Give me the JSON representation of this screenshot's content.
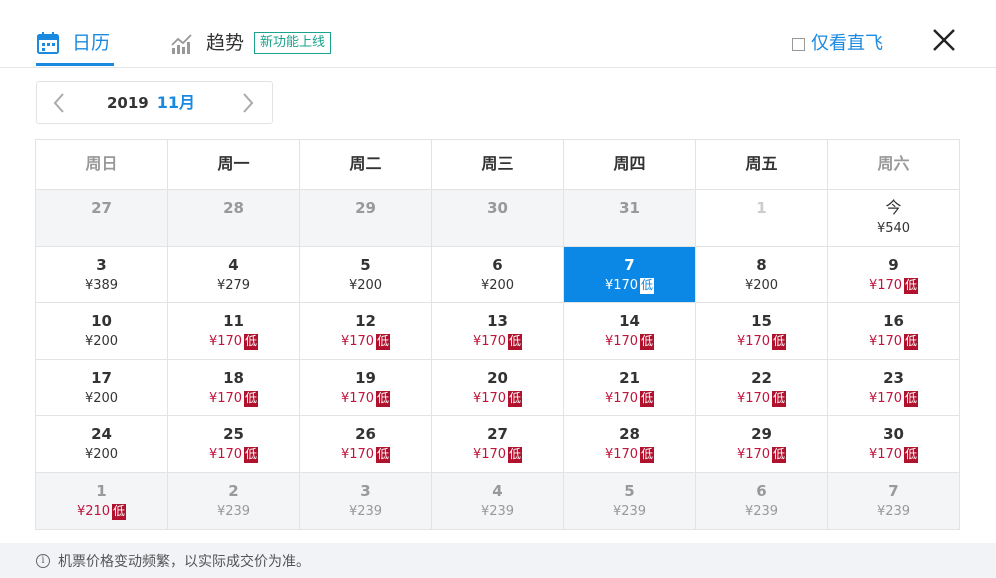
{
  "tabs": {
    "calendar": "日历",
    "trend": "趋势",
    "new_badge": "新功能上线"
  },
  "filter": {
    "direct_only": "仅看直飞"
  },
  "month_nav": {
    "year": "2019",
    "month": "11月"
  },
  "weekdays": [
    "周日",
    "周一",
    "周二",
    "周三",
    "周四",
    "周五",
    "周六"
  ],
  "low_tag": "低",
  "weeks": [
    [
      {
        "d": "27",
        "p": "",
        "other": true
      },
      {
        "d": "28",
        "p": "",
        "other": true
      },
      {
        "d": "29",
        "p": "",
        "other": true
      },
      {
        "d": "30",
        "p": "",
        "other": true
      },
      {
        "d": "31",
        "p": "",
        "other": true
      },
      {
        "d": "1",
        "p": "",
        "faded": true
      },
      {
        "d": "今",
        "p": "¥540",
        "today": true
      }
    ],
    [
      {
        "d": "3",
        "p": "¥389"
      },
      {
        "d": "4",
        "p": "¥279"
      },
      {
        "d": "5",
        "p": "¥200"
      },
      {
        "d": "6",
        "p": "¥200"
      },
      {
        "d": "7",
        "p": "¥170",
        "low": true,
        "selected": true
      },
      {
        "d": "8",
        "p": "¥200"
      },
      {
        "d": "9",
        "p": "¥170",
        "low": true
      }
    ],
    [
      {
        "d": "10",
        "p": "¥200"
      },
      {
        "d": "11",
        "p": "¥170",
        "low": true
      },
      {
        "d": "12",
        "p": "¥170",
        "low": true
      },
      {
        "d": "13",
        "p": "¥170",
        "low": true
      },
      {
        "d": "14",
        "p": "¥170",
        "low": true
      },
      {
        "d": "15",
        "p": "¥170",
        "low": true
      },
      {
        "d": "16",
        "p": "¥170",
        "low": true
      }
    ],
    [
      {
        "d": "17",
        "p": "¥200"
      },
      {
        "d": "18",
        "p": "¥170",
        "low": true
      },
      {
        "d": "19",
        "p": "¥170",
        "low": true
      },
      {
        "d": "20",
        "p": "¥170",
        "low": true
      },
      {
        "d": "21",
        "p": "¥170",
        "low": true
      },
      {
        "d": "22",
        "p": "¥170",
        "low": true
      },
      {
        "d": "23",
        "p": "¥170",
        "low": true
      }
    ],
    [
      {
        "d": "24",
        "p": "¥200"
      },
      {
        "d": "25",
        "p": "¥170",
        "low": true
      },
      {
        "d": "26",
        "p": "¥170",
        "low": true
      },
      {
        "d": "27",
        "p": "¥170",
        "low": true
      },
      {
        "d": "28",
        "p": "¥170",
        "low": true
      },
      {
        "d": "29",
        "p": "¥170",
        "low": true
      },
      {
        "d": "30",
        "p": "¥170",
        "low": true
      }
    ],
    [
      {
        "d": "1",
        "p": "¥210",
        "low": true,
        "other": true
      },
      {
        "d": "2",
        "p": "¥239",
        "other": true
      },
      {
        "d": "3",
        "p": "¥239",
        "other": true
      },
      {
        "d": "4",
        "p": "¥239",
        "other": true
      },
      {
        "d": "5",
        "p": "¥239",
        "other": true
      },
      {
        "d": "6",
        "p": "¥239",
        "other": true
      },
      {
        "d": "7",
        "p": "¥239",
        "other": true
      }
    ]
  ],
  "footer": {
    "note": "机票价格变动频繁，以实际成交价为准。",
    "info_glyph": "i"
  },
  "colors": {
    "accent": "#1a8ae0",
    "selected": "#0b88e6",
    "low_price": "#c0143c",
    "new_badge": "#1aa38a"
  }
}
